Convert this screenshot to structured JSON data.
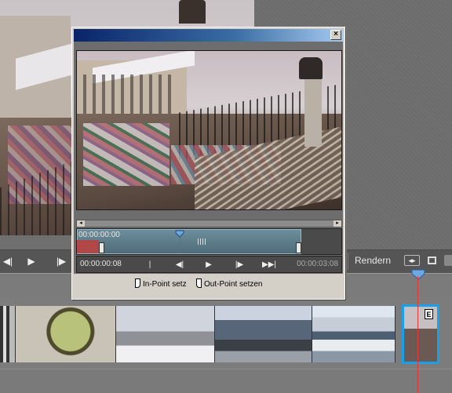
{
  "app": {
    "render_label": "Rendern"
  },
  "trim_dialog": {
    "close_label": "×",
    "trim_start_time": "00:00:00:00",
    "in_time": "00:00:00:08",
    "out_time": "00:00:03:08",
    "set_in_point_label": "In-Point setz",
    "set_out_point_label": "Out-Point setzen",
    "trim_range_fraction_start": 0.0,
    "trim_range_fraction_end": 0.85,
    "playhead_fraction": 0.39
  },
  "timeline": {
    "selected_clip_badge": "E"
  },
  "icons": {
    "close": "close-icon",
    "go_to_start": "skip-back-icon",
    "step_back": "step-back-icon",
    "play": "play-icon",
    "step_forward": "step-forward-icon",
    "go_to_end": "skip-forward-icon",
    "in_point": "in-point-icon",
    "out_point": "out-point-icon",
    "playhead": "playhead-icon"
  },
  "colors": {
    "accent_selection": "#1aa0e8",
    "playhead": "#e23a3a",
    "titlebar_start": "#0a246a",
    "titlebar_end": "#a6caf0"
  }
}
